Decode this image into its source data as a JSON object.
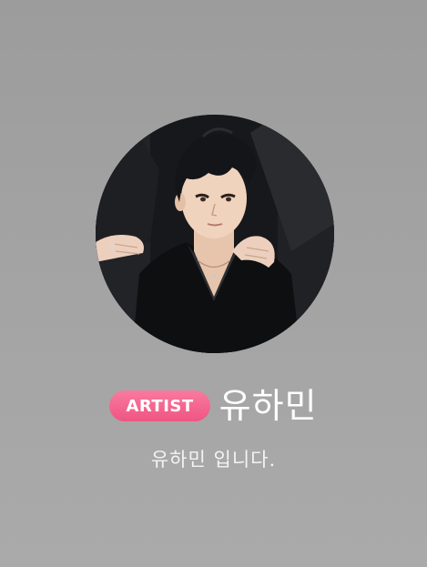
{
  "profile": {
    "badge_label": "ARTIST",
    "name": "유하민",
    "bio": "유하민 입니다."
  },
  "colors": {
    "background": "#a2a2a2",
    "badge": "#f46890",
    "text": "#ffffff"
  },
  "icons": {
    "avatar": "profile-avatar-illustration"
  }
}
